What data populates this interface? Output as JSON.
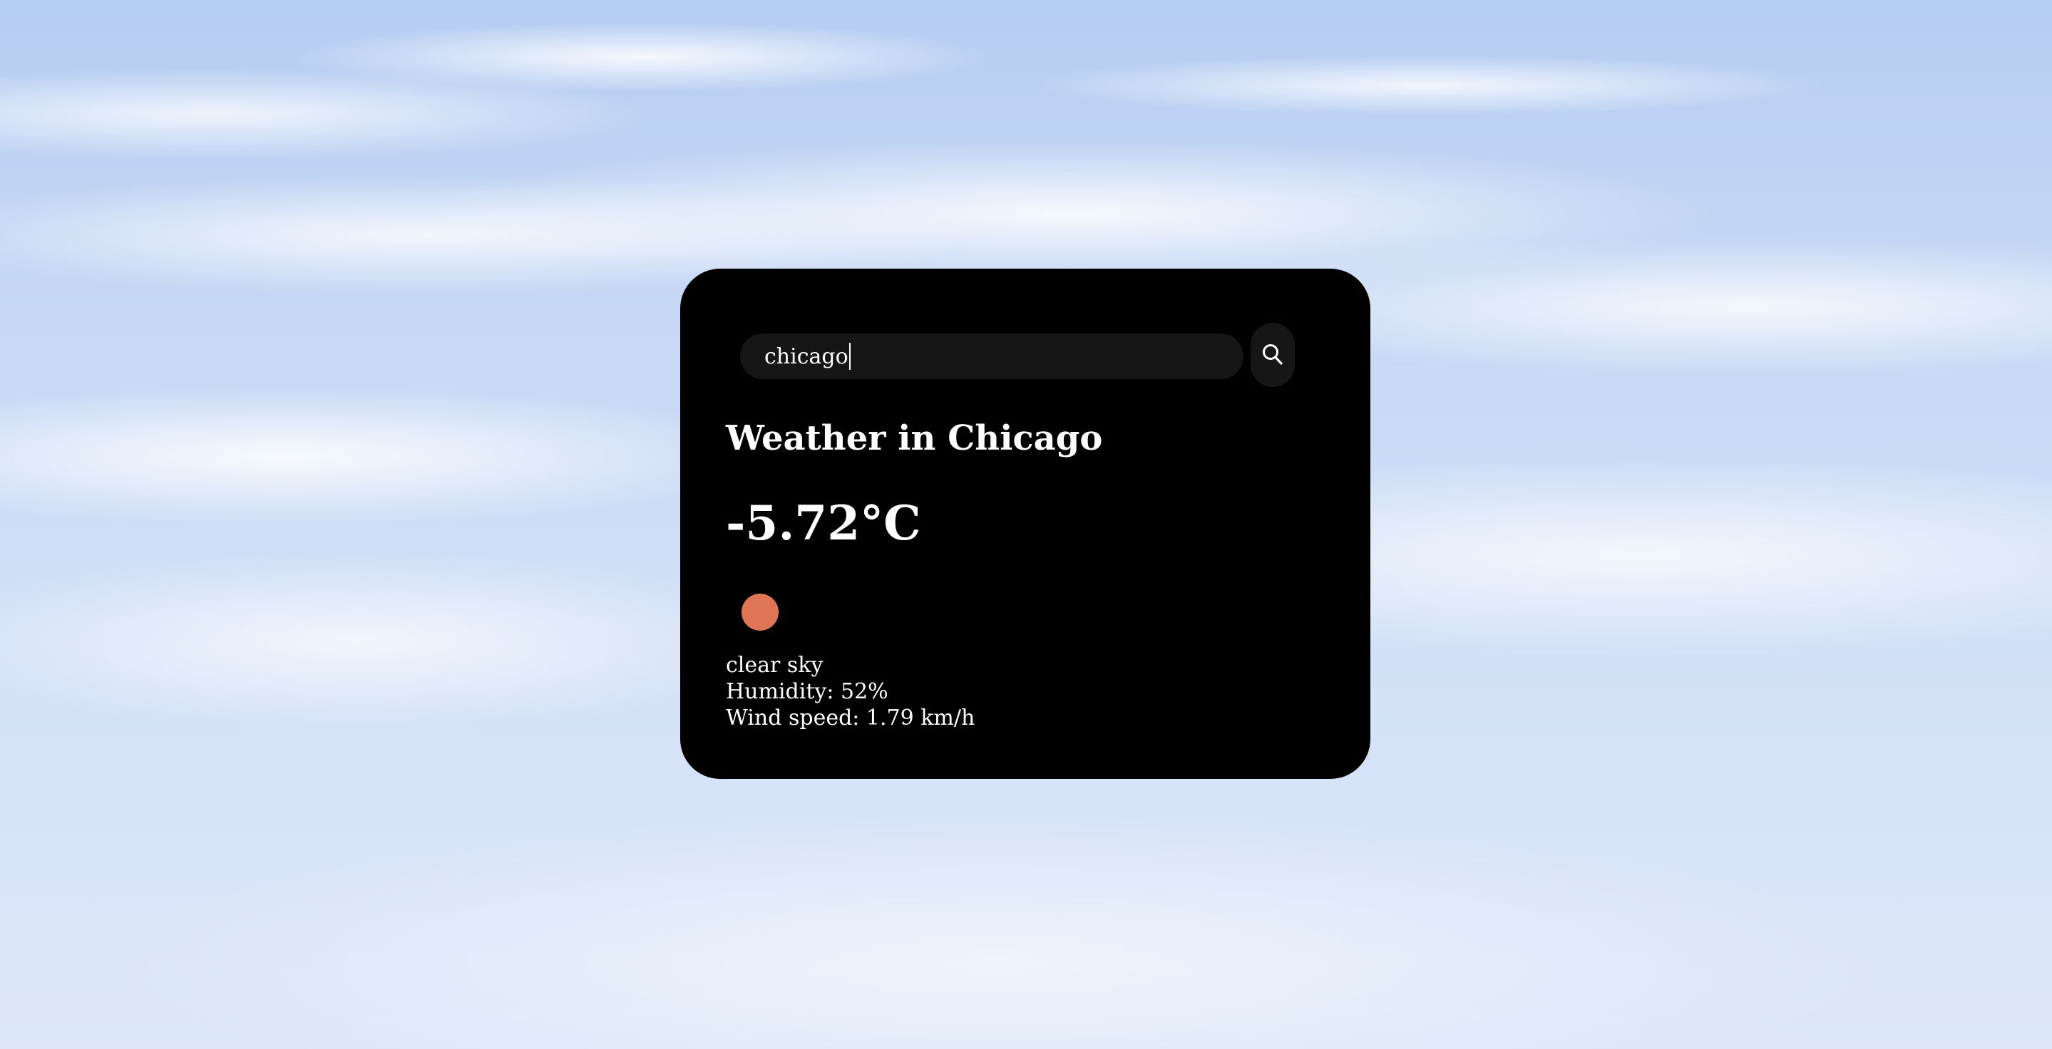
{
  "search": {
    "value": "chicago"
  },
  "weather": {
    "title": "Weather in Chicago",
    "temperature": "-5.72°C",
    "description": "clear sky",
    "humidity": "Humidity: 52%",
    "wind": "Wind speed: 1.79 km/h",
    "icon": "sun-icon"
  },
  "colors": {
    "card_bg": "#000000",
    "input_bg": "#161616",
    "icon_color": "#e07555",
    "text": "#ffffff"
  }
}
